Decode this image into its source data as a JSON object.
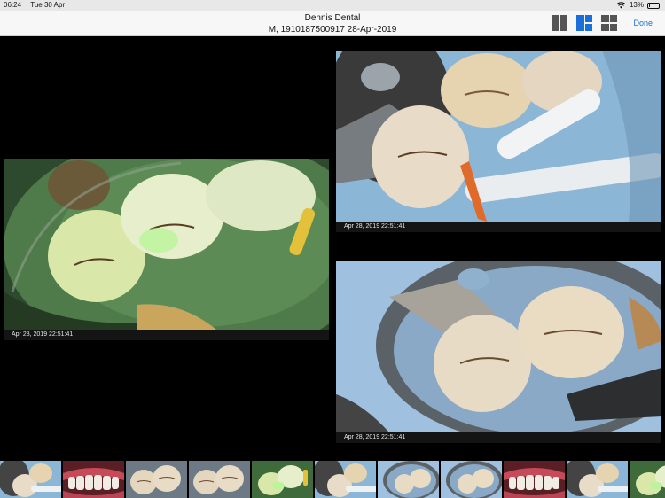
{
  "status": {
    "time": "06:24",
    "date": "Tue 30 Apr",
    "battery": "13%",
    "battery_level": 0.13
  },
  "header": {
    "title": "Dennis Dental",
    "subtitle": "M, 1910187500917 28-Apr-2019",
    "done_label": "Done",
    "layouts": [
      "two-column-icon",
      "one-plus-two-icon",
      "grid-icon"
    ],
    "active_layout": "one-plus-two-icon"
  },
  "photos": [
    {
      "caption": "Apr 28, 2019 22:51:41",
      "kind": "fluorescent"
    },
    {
      "caption": "Apr 28, 2019 22:51:41",
      "kind": "clamp"
    },
    {
      "caption": "Apr 28, 2019 22:51:41",
      "kind": "mirror"
    }
  ],
  "thumbnails": [
    "clamp",
    "smile",
    "molars",
    "molars",
    "fluorescent",
    "clamp",
    "mirror",
    "mirror",
    "smile",
    "clamp",
    "fluorescent"
  ],
  "colors": {
    "accent": "#1a6fd9",
    "icon_inactive": "#555555"
  }
}
